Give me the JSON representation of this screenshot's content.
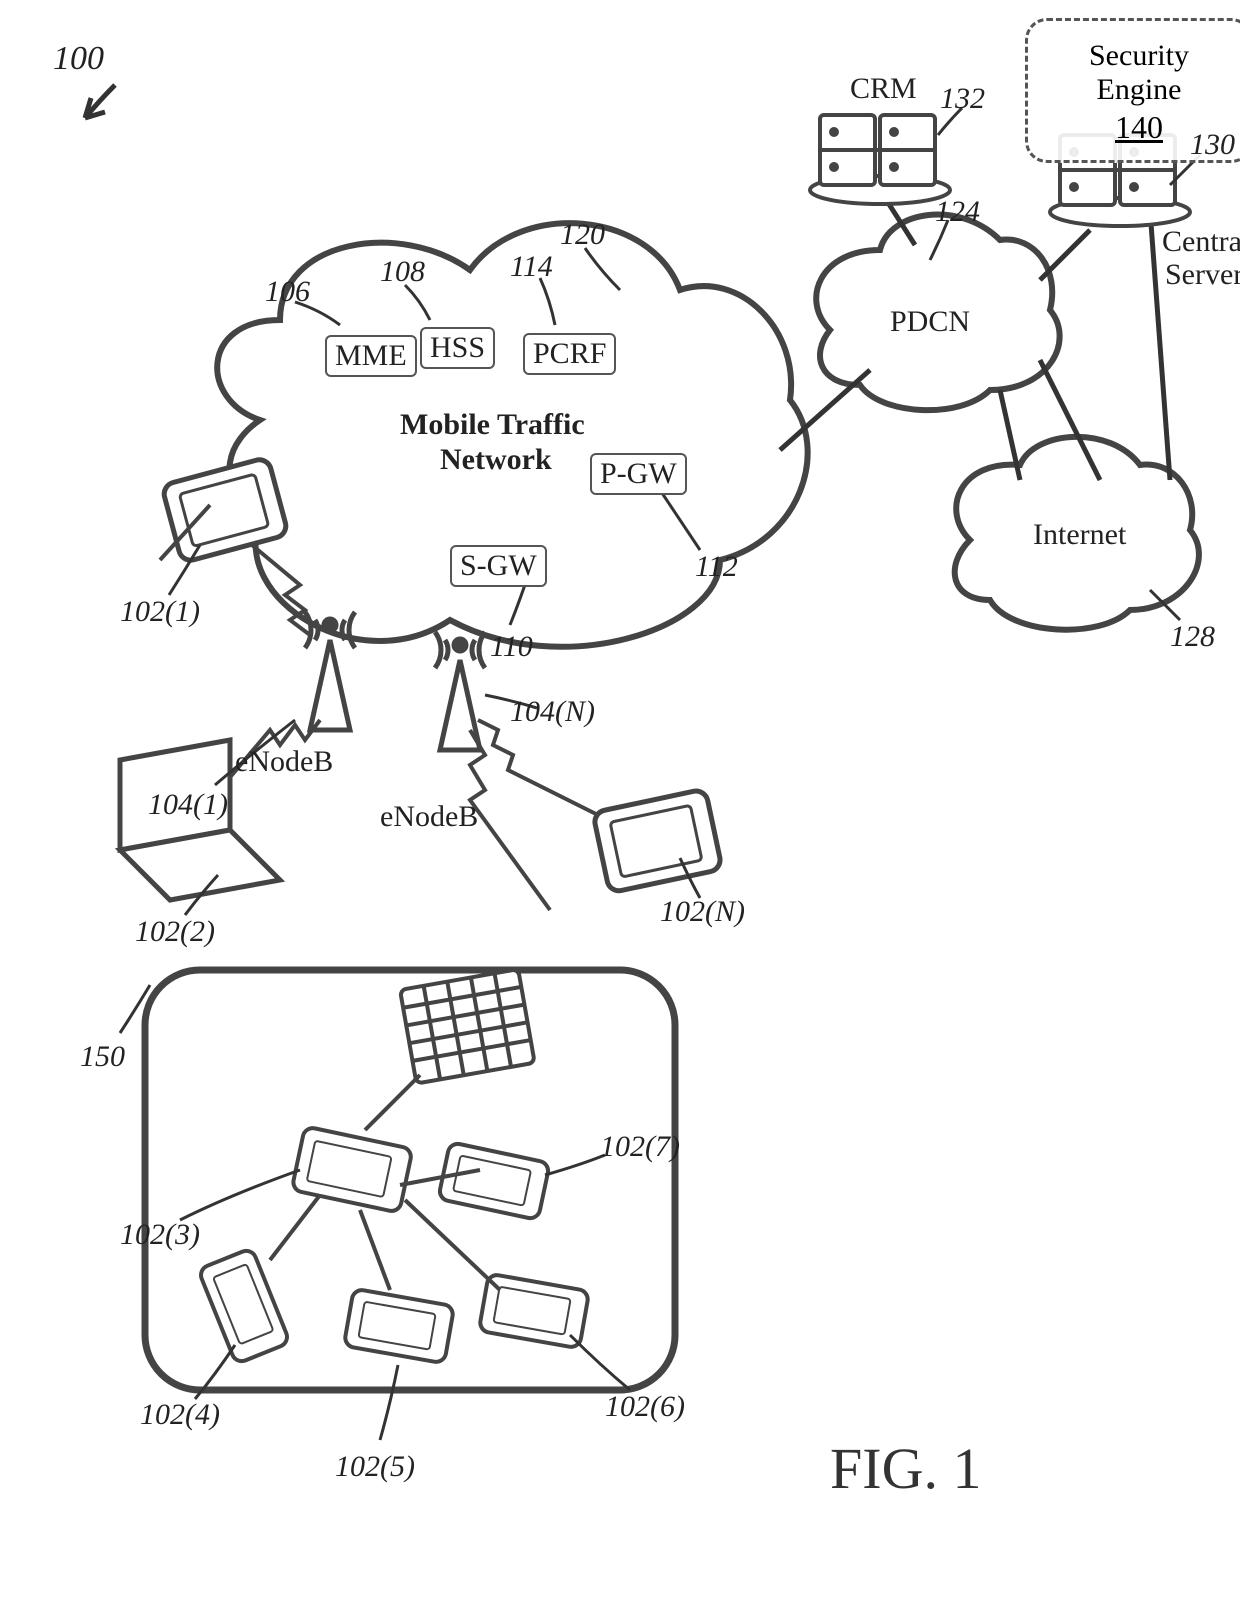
{
  "figure": {
    "number_label": "100",
    "title": "FIG. 1"
  },
  "clouds": {
    "mobile_traffic": {
      "title_line1": "Mobile Traffic",
      "title_line2": "Network",
      "ref": "120",
      "nodes": {
        "mme": {
          "label": "MME",
          "ref": "106"
        },
        "hss": {
          "label": "HSS",
          "ref": "108"
        },
        "pcrf": {
          "label": "PCRF",
          "ref": "114"
        },
        "sgw": {
          "label": "S-GW",
          "ref": "110"
        },
        "pgw": {
          "label": "P-GW",
          "ref": "112"
        }
      }
    },
    "pdcn": {
      "label": "PDCN",
      "ref": "124"
    },
    "internet": {
      "label": "Internet",
      "ref": "128"
    }
  },
  "servers": {
    "crm": {
      "label": "CRM",
      "ref": "132"
    },
    "central": {
      "label_l1": "Central",
      "label_l2": "Server",
      "ref": "130"
    }
  },
  "security_engine": {
    "title": "Security Engine",
    "ref": "140"
  },
  "enodeb": {
    "label": "eNodeB",
    "b1_ref": "104(1)",
    "bn_ref": "104(N)"
  },
  "devices": {
    "d1": "102(1)",
    "d2": "102(2)",
    "d3": "102(3)",
    "d4": "102(4)",
    "d5": "102(5)",
    "d6": "102(6)",
    "d7": "102(7)",
    "dN": "102(N)"
  },
  "group_box_ref": "150"
}
